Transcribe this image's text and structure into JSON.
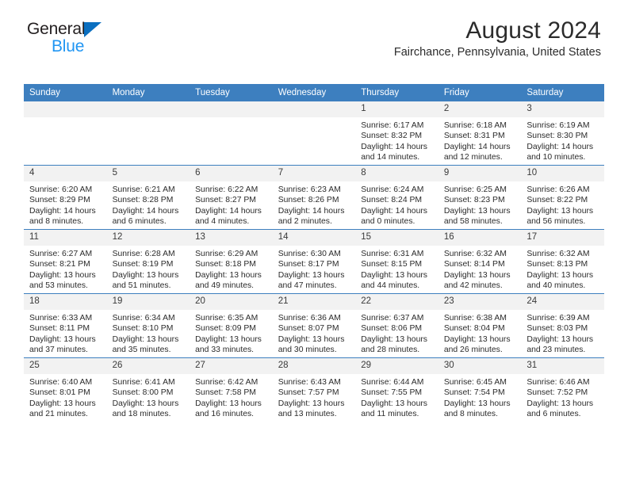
{
  "brand": {
    "line1": "General",
    "line2": "Blue",
    "flag_color": "#0b6fc0",
    "blue_color": "#2196f3"
  },
  "header": {
    "title": "August 2024",
    "subtitle": "Fairchance, Pennsylvania, United States"
  },
  "calendar": {
    "accent_color": "#3d7fbf",
    "weekdays": [
      "Sunday",
      "Monday",
      "Tuesday",
      "Wednesday",
      "Thursday",
      "Friday",
      "Saturday"
    ],
    "weeks": [
      [
        {
          "day": "",
          "empty": true
        },
        {
          "day": "",
          "empty": true
        },
        {
          "day": "",
          "empty": true
        },
        {
          "day": "",
          "empty": true
        },
        {
          "day": "1",
          "sunrise": "Sunrise: 6:17 AM",
          "sunset": "Sunset: 8:32 PM",
          "daylight1": "Daylight: 14 hours",
          "daylight2": "and 14 minutes."
        },
        {
          "day": "2",
          "sunrise": "Sunrise: 6:18 AM",
          "sunset": "Sunset: 8:31 PM",
          "daylight1": "Daylight: 14 hours",
          "daylight2": "and 12 minutes."
        },
        {
          "day": "3",
          "sunrise": "Sunrise: 6:19 AM",
          "sunset": "Sunset: 8:30 PM",
          "daylight1": "Daylight: 14 hours",
          "daylight2": "and 10 minutes."
        }
      ],
      [
        {
          "day": "4",
          "sunrise": "Sunrise: 6:20 AM",
          "sunset": "Sunset: 8:29 PM",
          "daylight1": "Daylight: 14 hours",
          "daylight2": "and 8 minutes."
        },
        {
          "day": "5",
          "sunrise": "Sunrise: 6:21 AM",
          "sunset": "Sunset: 8:28 PM",
          "daylight1": "Daylight: 14 hours",
          "daylight2": "and 6 minutes."
        },
        {
          "day": "6",
          "sunrise": "Sunrise: 6:22 AM",
          "sunset": "Sunset: 8:27 PM",
          "daylight1": "Daylight: 14 hours",
          "daylight2": "and 4 minutes."
        },
        {
          "day": "7",
          "sunrise": "Sunrise: 6:23 AM",
          "sunset": "Sunset: 8:26 PM",
          "daylight1": "Daylight: 14 hours",
          "daylight2": "and 2 minutes."
        },
        {
          "day": "8",
          "sunrise": "Sunrise: 6:24 AM",
          "sunset": "Sunset: 8:24 PM",
          "daylight1": "Daylight: 14 hours",
          "daylight2": "and 0 minutes."
        },
        {
          "day": "9",
          "sunrise": "Sunrise: 6:25 AM",
          "sunset": "Sunset: 8:23 PM",
          "daylight1": "Daylight: 13 hours",
          "daylight2": "and 58 minutes."
        },
        {
          "day": "10",
          "sunrise": "Sunrise: 6:26 AM",
          "sunset": "Sunset: 8:22 PM",
          "daylight1": "Daylight: 13 hours",
          "daylight2": "and 56 minutes."
        }
      ],
      [
        {
          "day": "11",
          "sunrise": "Sunrise: 6:27 AM",
          "sunset": "Sunset: 8:21 PM",
          "daylight1": "Daylight: 13 hours",
          "daylight2": "and 53 minutes."
        },
        {
          "day": "12",
          "sunrise": "Sunrise: 6:28 AM",
          "sunset": "Sunset: 8:19 PM",
          "daylight1": "Daylight: 13 hours",
          "daylight2": "and 51 minutes."
        },
        {
          "day": "13",
          "sunrise": "Sunrise: 6:29 AM",
          "sunset": "Sunset: 8:18 PM",
          "daylight1": "Daylight: 13 hours",
          "daylight2": "and 49 minutes."
        },
        {
          "day": "14",
          "sunrise": "Sunrise: 6:30 AM",
          "sunset": "Sunset: 8:17 PM",
          "daylight1": "Daylight: 13 hours",
          "daylight2": "and 47 minutes."
        },
        {
          "day": "15",
          "sunrise": "Sunrise: 6:31 AM",
          "sunset": "Sunset: 8:15 PM",
          "daylight1": "Daylight: 13 hours",
          "daylight2": "and 44 minutes."
        },
        {
          "day": "16",
          "sunrise": "Sunrise: 6:32 AM",
          "sunset": "Sunset: 8:14 PM",
          "daylight1": "Daylight: 13 hours",
          "daylight2": "and 42 minutes."
        },
        {
          "day": "17",
          "sunrise": "Sunrise: 6:32 AM",
          "sunset": "Sunset: 8:13 PM",
          "daylight1": "Daylight: 13 hours",
          "daylight2": "and 40 minutes."
        }
      ],
      [
        {
          "day": "18",
          "sunrise": "Sunrise: 6:33 AM",
          "sunset": "Sunset: 8:11 PM",
          "daylight1": "Daylight: 13 hours",
          "daylight2": "and 37 minutes."
        },
        {
          "day": "19",
          "sunrise": "Sunrise: 6:34 AM",
          "sunset": "Sunset: 8:10 PM",
          "daylight1": "Daylight: 13 hours",
          "daylight2": "and 35 minutes."
        },
        {
          "day": "20",
          "sunrise": "Sunrise: 6:35 AM",
          "sunset": "Sunset: 8:09 PM",
          "daylight1": "Daylight: 13 hours",
          "daylight2": "and 33 minutes."
        },
        {
          "day": "21",
          "sunrise": "Sunrise: 6:36 AM",
          "sunset": "Sunset: 8:07 PM",
          "daylight1": "Daylight: 13 hours",
          "daylight2": "and 30 minutes."
        },
        {
          "day": "22",
          "sunrise": "Sunrise: 6:37 AM",
          "sunset": "Sunset: 8:06 PM",
          "daylight1": "Daylight: 13 hours",
          "daylight2": "and 28 minutes."
        },
        {
          "day": "23",
          "sunrise": "Sunrise: 6:38 AM",
          "sunset": "Sunset: 8:04 PM",
          "daylight1": "Daylight: 13 hours",
          "daylight2": "and 26 minutes."
        },
        {
          "day": "24",
          "sunrise": "Sunrise: 6:39 AM",
          "sunset": "Sunset: 8:03 PM",
          "daylight1": "Daylight: 13 hours",
          "daylight2": "and 23 minutes."
        }
      ],
      [
        {
          "day": "25",
          "sunrise": "Sunrise: 6:40 AM",
          "sunset": "Sunset: 8:01 PM",
          "daylight1": "Daylight: 13 hours",
          "daylight2": "and 21 minutes."
        },
        {
          "day": "26",
          "sunrise": "Sunrise: 6:41 AM",
          "sunset": "Sunset: 8:00 PM",
          "daylight1": "Daylight: 13 hours",
          "daylight2": "and 18 minutes."
        },
        {
          "day": "27",
          "sunrise": "Sunrise: 6:42 AM",
          "sunset": "Sunset: 7:58 PM",
          "daylight1": "Daylight: 13 hours",
          "daylight2": "and 16 minutes."
        },
        {
          "day": "28",
          "sunrise": "Sunrise: 6:43 AM",
          "sunset": "Sunset: 7:57 PM",
          "daylight1": "Daylight: 13 hours",
          "daylight2": "and 13 minutes."
        },
        {
          "day": "29",
          "sunrise": "Sunrise: 6:44 AM",
          "sunset": "Sunset: 7:55 PM",
          "daylight1": "Daylight: 13 hours",
          "daylight2": "and 11 minutes."
        },
        {
          "day": "30",
          "sunrise": "Sunrise: 6:45 AM",
          "sunset": "Sunset: 7:54 PM",
          "daylight1": "Daylight: 13 hours",
          "daylight2": "and 8 minutes."
        },
        {
          "day": "31",
          "sunrise": "Sunrise: 6:46 AM",
          "sunset": "Sunset: 7:52 PM",
          "daylight1": "Daylight: 13 hours",
          "daylight2": "and 6 minutes."
        }
      ]
    ]
  }
}
